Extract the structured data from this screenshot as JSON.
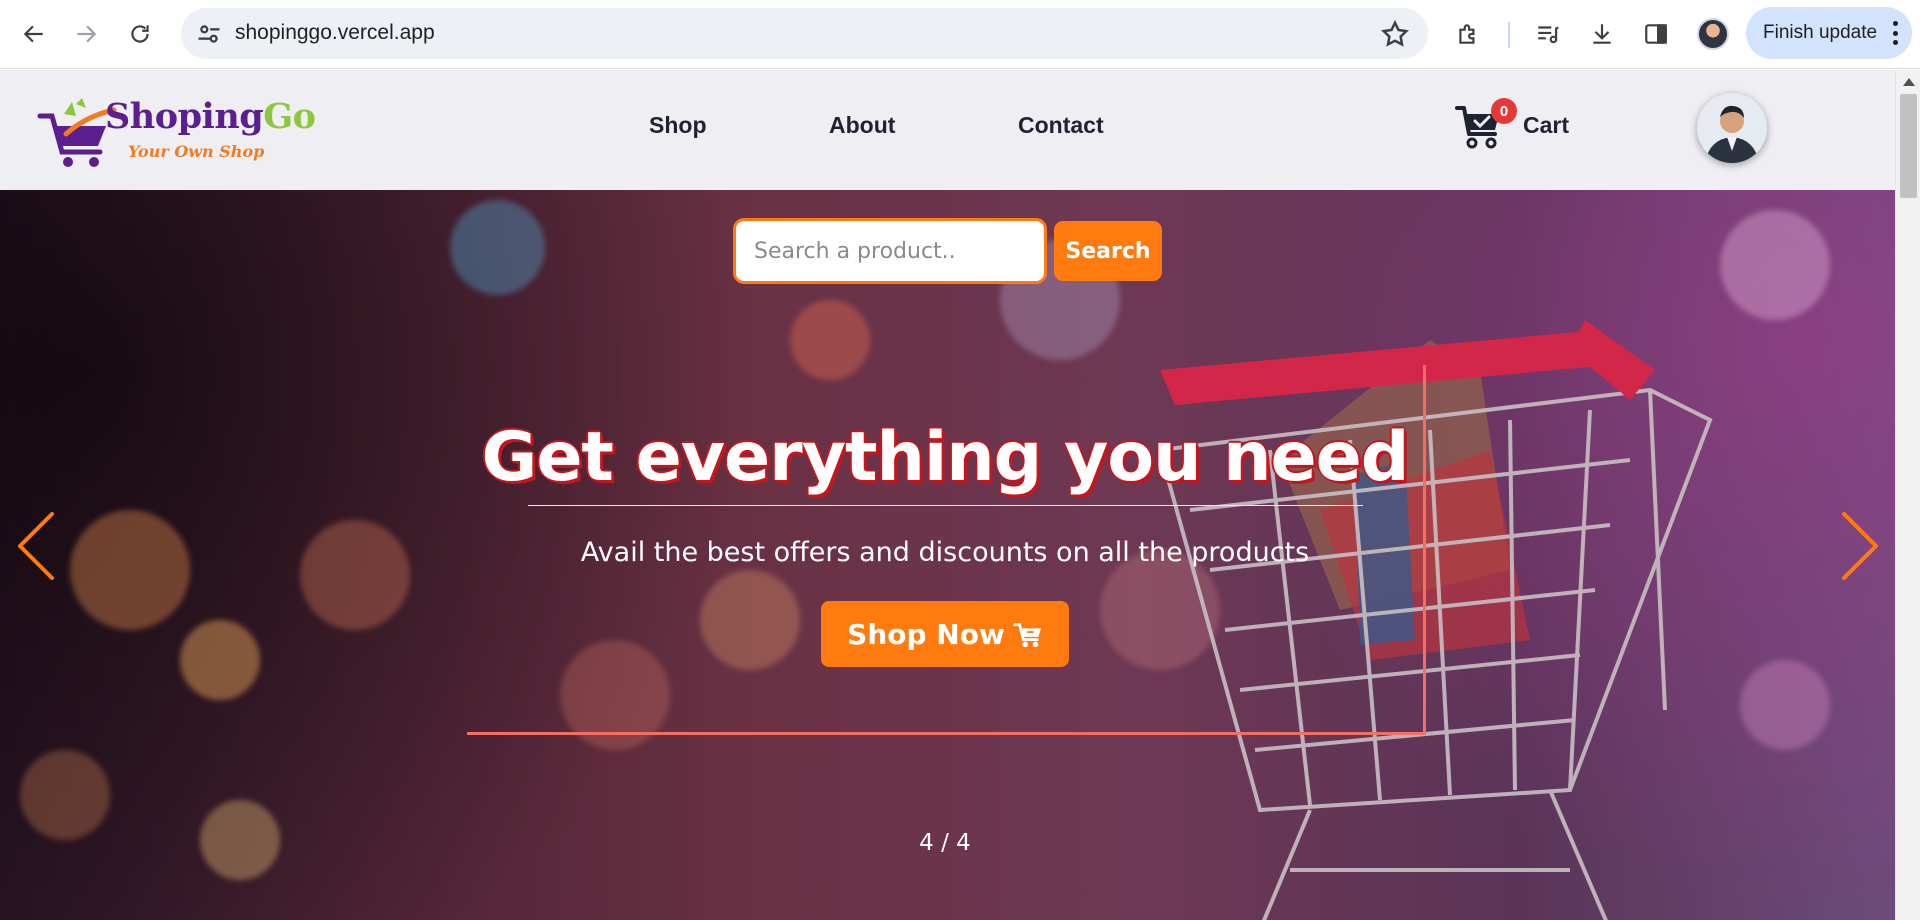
{
  "browser": {
    "url": "shopinggo.vercel.app",
    "finish_update_label": "Finish update"
  },
  "site": {
    "logo": {
      "name_part1": "Shoping",
      "name_part2": "Go",
      "tagline": "Your Own Shop"
    },
    "nav": [
      {
        "label": "Shop"
      },
      {
        "label": "About"
      },
      {
        "label": "Contact"
      }
    ],
    "cart": {
      "label": "Cart",
      "count": "0"
    }
  },
  "hero": {
    "search": {
      "placeholder": "Search a product..",
      "button_label": "Search"
    },
    "title": "Get everything you need",
    "subtitle": "Avail the best offers and discounts on all the products",
    "cta_label": "Shop Now",
    "slide_counter": "4 / 4"
  },
  "colors": {
    "accent": "#ff7b0f",
    "brand_purple": "#5b1f8f",
    "brand_green": "#8dc63f",
    "badge_red": "#e53935",
    "frame_line": "#f36e63"
  },
  "icons": [
    "back-icon",
    "forward-icon",
    "reload-icon",
    "site-info-icon",
    "bookmark-star-icon",
    "extensions-icon",
    "media-playlist-icon",
    "download-icon",
    "side-panel-icon",
    "cart-icon",
    "chevron-left-icon",
    "chevron-right-icon"
  ]
}
